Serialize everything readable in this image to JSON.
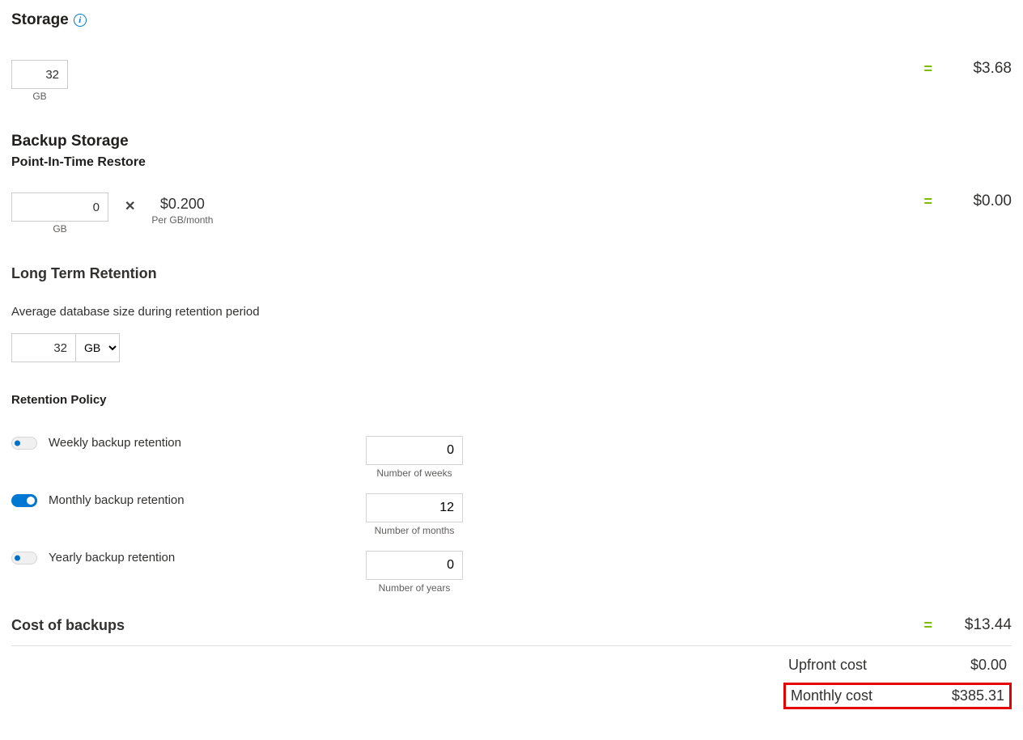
{
  "storage": {
    "title": "Storage",
    "value": "32",
    "unit": "GB",
    "cost": "$3.68"
  },
  "backup": {
    "title": "Backup Storage",
    "subtitle": "Point-In-Time Restore",
    "value": "0",
    "unit": "GB",
    "price": "$0.200",
    "price_caption": "Per GB/month",
    "multiply": "✕",
    "cost": "$0.00"
  },
  "ltr": {
    "title": "Long Term Retention",
    "avg_label": "Average database size during retention period",
    "avg_value": "32",
    "avg_unit": "GB",
    "policy_title": "Retention Policy",
    "weekly": {
      "label": "Weekly backup retention",
      "on": false,
      "value": "0",
      "caption": "Number of weeks"
    },
    "monthly": {
      "label": "Monthly backup retention",
      "on": true,
      "value": "12",
      "caption": "Number of months"
    },
    "yearly": {
      "label": "Yearly backup retention",
      "on": false,
      "value": "0",
      "caption": "Number of years"
    }
  },
  "backups_cost": {
    "title": "Cost of backups",
    "cost": "$13.44"
  },
  "equals": "=",
  "totals": {
    "upfront_label": "Upfront cost",
    "upfront_value": "$0.00",
    "monthly_label": "Monthly cost",
    "monthly_value": "$385.31"
  }
}
